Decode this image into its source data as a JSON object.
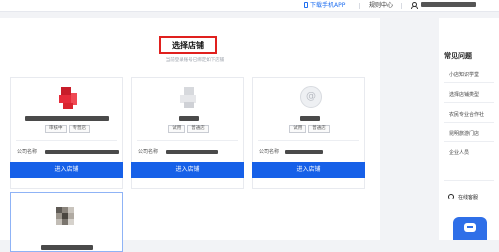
{
  "topbar": {
    "app_download": "下载手机APP",
    "help_center": "规则中心"
  },
  "main": {
    "title": "选择店铺",
    "subtitle": "当前登录账号已绑定如下店铺"
  },
  "cards": [
    {
      "tags": [
        "审核中",
        "专营店"
      ],
      "company_label": "公司名称",
      "enter_label": "进入店铺"
    },
    {
      "tags": [
        "试用",
        "普通店"
      ],
      "company_label": "公司名称",
      "enter_label": "进入店铺"
    },
    {
      "tags": [
        "试用",
        "普通店"
      ],
      "company_label": "公司名称",
      "enter_label": "进入店铺"
    }
  ],
  "sidebar": {
    "title": "常见问题",
    "items": [
      "小店知识学堂",
      "选择店铺类型",
      "农民专业合作社",
      "昆明旅游门店",
      "企业人员"
    ],
    "service": "在线客服"
  },
  "colors": {
    "primary": "#1660e8",
    "highlight": "#e0201e"
  },
  "icons": {
    "app": "phone-icon",
    "user": "user-icon",
    "service": "headset-icon",
    "fab": "chat-icon"
  }
}
